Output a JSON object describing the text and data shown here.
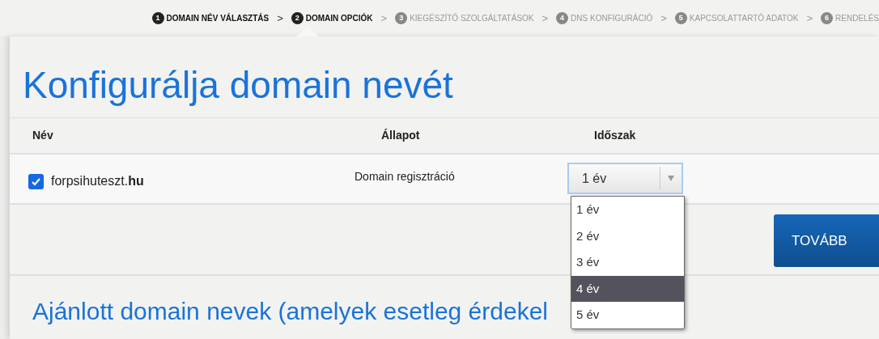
{
  "steps": [
    {
      "number": "1",
      "label": "DOMAIN NÉV VÁLASZTÁS",
      "active": true,
      "selected": false
    },
    {
      "number": "2",
      "label": "DOMAIN OPCIÓK",
      "active": true,
      "selected": true
    },
    {
      "number": "3",
      "label": "KIEGÉSZÍTŐ SZOLGÁLTATÁSOK",
      "active": false,
      "selected": false
    },
    {
      "number": "4",
      "label": "DNS KONFIGURÁCIÓ",
      "active": false,
      "selected": false
    },
    {
      "number": "5",
      "label": "KAPCSOLATTARTÓ ADATOK",
      "active": false,
      "selected": false
    },
    {
      "number": "6",
      "label": "RENDELÉS",
      "active": false,
      "selected": false
    }
  ],
  "separator": ">",
  "title": "Konfigurálja domain nevét",
  "table": {
    "columns": [
      "Név",
      "Állapot",
      "Időszak"
    ],
    "rows": [
      {
        "checked": true,
        "name": "forpsihuteszt.**hu**",
        "status": "Domain regisztráció",
        "period": {
          "value": "1 év",
          "open": true,
          "options": [
            {
              "label": "1 év",
              "highlighted": false
            },
            {
              "label": "2 év",
              "highlighted": false
            },
            {
              "label": "3 év",
              "highlighted": false
            },
            {
              "label": "4 év",
              "highlighted": true
            },
            {
              "label": "5 év",
              "highlighted": false
            }
          ]
        }
      }
    ]
  },
  "next_button": "TOVÁBB",
  "suggestions_title": "Ajánlott domain nevek (amelyek esetleg érdekel"
}
